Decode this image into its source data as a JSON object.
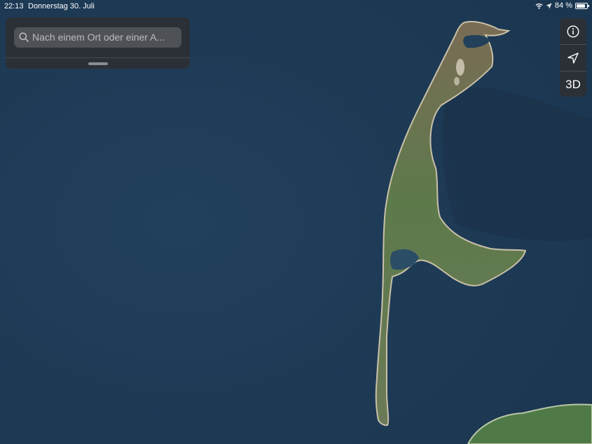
{
  "status_bar": {
    "time": "22:13",
    "date": "Donnerstag 30. Juli",
    "battery_text": "84 %",
    "battery_level": 0.84
  },
  "search": {
    "placeholder": "Nach einem Ort oder einer A..."
  },
  "map_controls": {
    "threed_label": "3D",
    "icons": [
      "info-icon",
      "location-arrow-icon"
    ]
  },
  "colors": {
    "sea": "#1f3b55",
    "land": "#4e6b45",
    "panel": "#2c3034"
  }
}
